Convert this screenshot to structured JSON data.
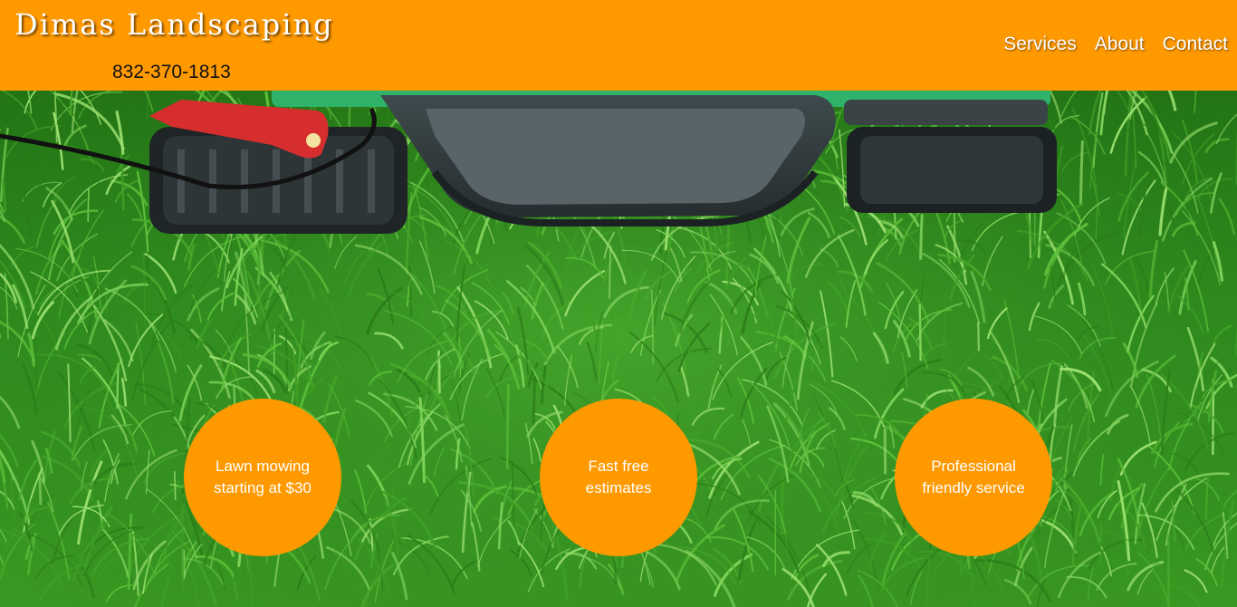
{
  "header": {
    "brand": "Dimas Landscaping",
    "phone": "832-370-1813",
    "nav": [
      {
        "label": "Services"
      },
      {
        "label": "About"
      },
      {
        "label": "Contact"
      }
    ]
  },
  "features": [
    {
      "text": "Lawn mowing starting at $30"
    },
    {
      "text": "Fast free estimates"
    },
    {
      "text": "Professional friendly service"
    }
  ],
  "colors": {
    "accent": "#ff9900",
    "text_light": "#ffffff",
    "text_dark": "#111111"
  },
  "hero": {
    "image": "lawn-mower-on-grass"
  }
}
